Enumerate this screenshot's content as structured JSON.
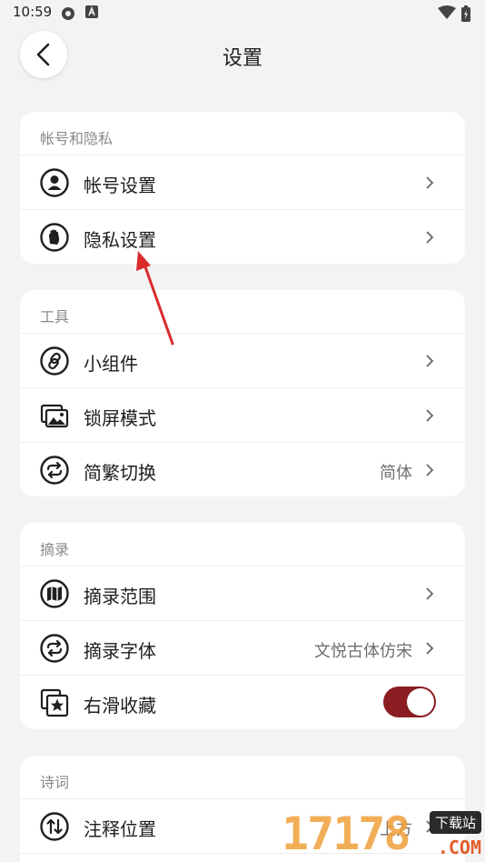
{
  "status_bar": {
    "time": "10:59"
  },
  "header": {
    "title": "设置"
  },
  "sections": {
    "account": {
      "title": "帐号和隐私",
      "items": [
        {
          "label": "帐号设置",
          "icon": "user-circle-icon"
        },
        {
          "label": "隐私设置",
          "icon": "hand-stop-icon"
        }
      ]
    },
    "tools": {
      "title": "工具",
      "items": [
        {
          "label": "小组件",
          "icon": "link-icon"
        },
        {
          "label": "锁屏模式",
          "icon": "image-stack-icon"
        },
        {
          "label": "简繁切换",
          "value": "简体",
          "icon": "swap-circle-icon"
        }
      ]
    },
    "excerpt": {
      "title": "摘录",
      "items": [
        {
          "label": "摘录范围",
          "icon": "map-icon"
        },
        {
          "label": "摘录字体",
          "value": "文悦古体仿宋",
          "icon": "swap-circle-icon"
        },
        {
          "label": "右滑收藏",
          "icon": "star-square-icon",
          "toggle": true
        }
      ]
    },
    "poetry": {
      "title": "诗词",
      "items": [
        {
          "label": "注释位置",
          "value": "上方",
          "icon": "up-down-circle-icon"
        }
      ]
    }
  },
  "colors": {
    "accent": "#8a1c22",
    "annotation_arrow": "#d92b2b"
  },
  "watermark": {
    "number": "17178",
    "badge": "下载站",
    "suffix": ".COM"
  }
}
